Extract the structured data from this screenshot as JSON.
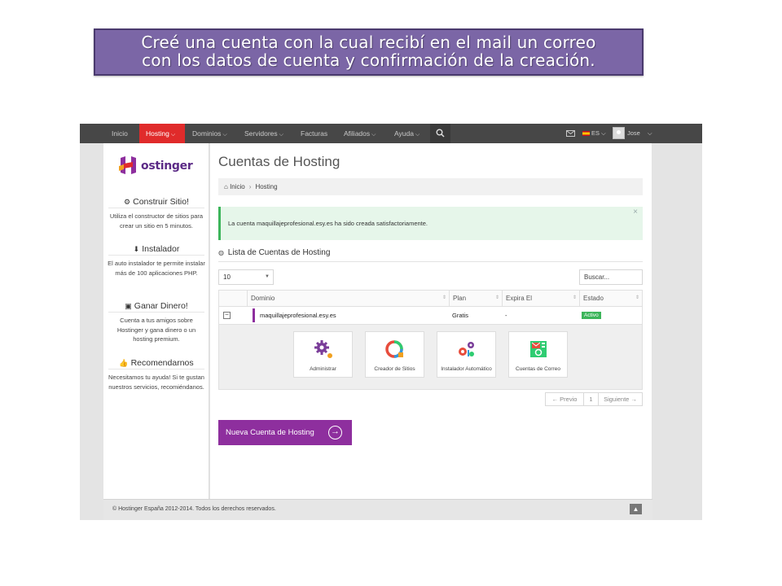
{
  "caption": {
    "line1": "Creé una cuenta con la cual recibí en el mail un correo",
    "line2": "con los datos de cuenta y confirmación de la creación."
  },
  "nav": {
    "items": [
      "Inicio",
      "Hosting",
      "Dominios",
      "Servidores",
      "Facturas",
      "Afiliados",
      "Ayuda"
    ],
    "active": "Hosting",
    "language": "ES",
    "user": "Jose"
  },
  "sidebar": {
    "logo_text": "ostinger",
    "blocks": [
      {
        "title": "Construir Sitio!",
        "text": "Utiliza el constructor de sitios para crear un sitio en 5 minutos."
      },
      {
        "title": "Instalador",
        "text": "El auto instalador te permite instalar más de 100 aplicaciones PHP."
      },
      {
        "title": "Ganar Dinero!",
        "text": "Cuenta a tus amigos sobre Hostinger y gana dinero o un hosting premium."
      },
      {
        "title": "Recomendarnos",
        "text": "Necesitamos tu ayuda! Si te gustan nuestros servicios, recomiéndanos."
      }
    ]
  },
  "main": {
    "title": "Cuentas de Hosting",
    "breadcrumb": [
      "Inicio",
      "Hosting"
    ],
    "alert": "La cuenta maquillajeprofesional.esy.es ha sido creada satisfactoriamente.",
    "section_title": "Lista de Cuentas de Hosting",
    "page_size": "10",
    "search_placeholder": "Buscar...",
    "columns": [
      "Dominio",
      "Plan",
      "Expira El",
      "Estado"
    ],
    "row": {
      "domain": "maquillajeprofesional.esy.es",
      "plan": "Gratis",
      "expires": "-",
      "status": "Activo"
    },
    "tiles": [
      "Administrar",
      "Creador de Sitios",
      "Instalador Automático",
      "Cuentas de Correo"
    ],
    "pager": {
      "prev": "← Previo",
      "page": "1",
      "next": "Siguiente →"
    },
    "new_button": "Nueva Cuenta de Hosting"
  },
  "footer": {
    "text": "© Hostinger España 2012-2014. Todos los derechos reservados."
  },
  "colors": {
    "caption_bg": "#7b66a6",
    "nav_bg": "#474747",
    "nav_active": "#e02b2b",
    "brand_purple": "#8e2f9e",
    "success": "#3cb55a"
  }
}
